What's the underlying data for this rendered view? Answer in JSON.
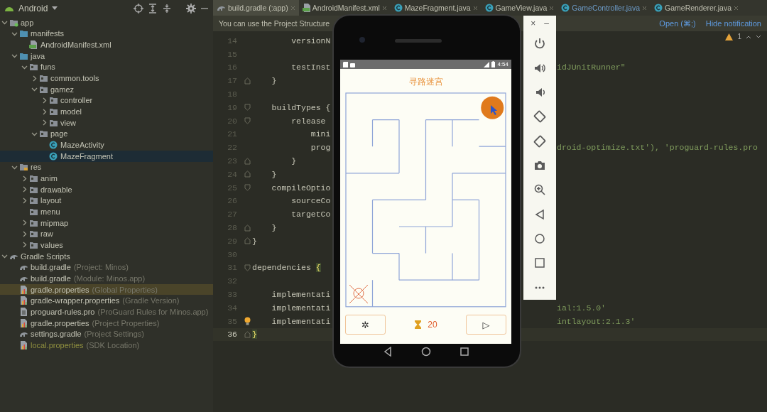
{
  "project_panel": {
    "view": "Android",
    "tree": [
      {
        "label": "app",
        "kind": "module",
        "expanded": true,
        "selected": false,
        "hovered": false,
        "children": [
          {
            "label": "manifests",
            "kind": "source-folder",
            "expanded": true,
            "selected": false,
            "hovered": false,
            "children": [
              {
                "label": "AndroidManifest.xml",
                "kind": "manifest",
                "selected": false,
                "hovered": false
              }
            ]
          },
          {
            "label": "java",
            "kind": "source-folder",
            "expanded": true,
            "selected": false,
            "hovered": false,
            "children": [
              {
                "label": "funs",
                "kind": "package",
                "expanded": true,
                "selected": false,
                "hovered": false,
                "children": [
                  {
                    "label": "common.tools",
                    "kind": "package",
                    "expanded": false,
                    "selected": false,
                    "hovered": false
                  },
                  {
                    "label": "gamez",
                    "kind": "package",
                    "expanded": true,
                    "selected": false,
                    "hovered": false,
                    "children": [
                      {
                        "label": "controller",
                        "kind": "package",
                        "expanded": false,
                        "selected": false,
                        "hovered": false
                      },
                      {
                        "label": "model",
                        "kind": "package",
                        "expanded": false,
                        "selected": false,
                        "hovered": false
                      },
                      {
                        "label": "view",
                        "kind": "package",
                        "expanded": false,
                        "selected": false,
                        "hovered": false
                      }
                    ]
                  },
                  {
                    "label": "page",
                    "kind": "package",
                    "expanded": true,
                    "selected": false,
                    "hovered": false,
                    "children": [
                      {
                        "label": "MazeActivity",
                        "kind": "class",
                        "selected": false,
                        "hovered": false
                      },
                      {
                        "label": "MazeFragment",
                        "kind": "class",
                        "selected": true,
                        "hovered": false
                      }
                    ]
                  }
                ]
              }
            ]
          },
          {
            "label": "res",
            "kind": "res-folder",
            "expanded": true,
            "selected": false,
            "hovered": false,
            "children": [
              {
                "label": "anim",
                "kind": "package",
                "expanded": false,
                "selected": false,
                "hovered": false
              },
              {
                "label": "drawable",
                "kind": "package",
                "expanded": false,
                "selected": false,
                "hovered": false
              },
              {
                "label": "layout",
                "kind": "package",
                "expanded": false,
                "selected": false,
                "hovered": false
              },
              {
                "label": "menu",
                "kind": "package",
                "selected": false,
                "hovered": false
              },
              {
                "label": "mipmap",
                "kind": "package",
                "expanded": false,
                "selected": false,
                "hovered": false
              },
              {
                "label": "raw",
                "kind": "package",
                "expanded": false,
                "selected": false,
                "hovered": false
              },
              {
                "label": "values",
                "kind": "package",
                "expanded": false,
                "selected": false,
                "hovered": false
              }
            ]
          }
        ]
      },
      {
        "label": "Gradle Scripts",
        "kind": "gradle",
        "expanded": true,
        "selected": false,
        "hovered": false,
        "children": [
          {
            "label": "build.gradle",
            "note": "(Project: Minos)",
            "kind": "gradle",
            "selected": false,
            "hovered": false
          },
          {
            "label": "build.gradle",
            "note": "(Module: Minos.app)",
            "kind": "gradle",
            "selected": false,
            "hovered": false
          },
          {
            "label": "gradle.properties",
            "note": "(Global Properties)",
            "kind": "properties",
            "selected": false,
            "hovered": true
          },
          {
            "label": "gradle-wrapper.properties",
            "note": "(Gradle Version)",
            "kind": "properties",
            "selected": false,
            "hovered": false
          },
          {
            "label": "proguard-rules.pro",
            "note": "(ProGuard Rules for Minos.app)",
            "kind": "file",
            "selected": false,
            "hovered": false
          },
          {
            "label": "gradle.properties",
            "note": "(Project Properties)",
            "kind": "properties",
            "selected": false,
            "hovered": false
          },
          {
            "label": "settings.gradle",
            "note": "(Project Settings)",
            "kind": "gradle",
            "selected": false,
            "hovered": false
          },
          {
            "label": "local.properties",
            "note": "(SDK Location)",
            "kind": "ignored-properties",
            "selected": false,
            "hovered": false
          }
        ]
      }
    ]
  },
  "editor": {
    "tabs": [
      {
        "label": "build.gradle (:app)",
        "kind": "gradle",
        "selected": true,
        "modified": false
      },
      {
        "label": "AndroidManifest.xml",
        "kind": "manifest",
        "selected": false,
        "modified": false
      },
      {
        "label": "MazeFragment.java",
        "kind": "class",
        "selected": false,
        "modified": false
      },
      {
        "label": "GameView.java",
        "kind": "class",
        "selected": false,
        "modified": false
      },
      {
        "label": "GameController.java",
        "kind": "class",
        "selected": false,
        "modified": true
      },
      {
        "label": "GameRenderer.java",
        "kind": "class",
        "selected": false,
        "modified": false
      }
    ],
    "notification": {
      "text": "You can use the Project Structure",
      "actions": [
        "Open (⌘;)",
        "Hide notification"
      ]
    },
    "warnings": "1",
    "lines": [
      {
        "number": "14",
        "kind": "plain",
        "code": "        versionN",
        "current": false
      },
      {
        "number": "15",
        "kind": "plain",
        "current": false
      },
      {
        "number": "16",
        "kind": "plain",
        "code": "        testInst",
        "tail": "idJUnitRunner\"",
        "current": false
      },
      {
        "number": "17",
        "kind": "fold-end",
        "code": "    }",
        "current": false
      },
      {
        "number": "18",
        "kind": "plain",
        "current": false
      },
      {
        "number": "19",
        "kind": "fold-start",
        "code": "    buildTypes {",
        "current": false
      },
      {
        "number": "20",
        "kind": "fold-start",
        "code": "        release",
        "current": false
      },
      {
        "number": "21",
        "kind": "plain",
        "code": "            mini",
        "current": false
      },
      {
        "number": "22",
        "kind": "plain",
        "code": "            prog",
        "tail": "droid-optimize.txt'), 'proguard-rules.pro",
        "current": false
      },
      {
        "number": "23",
        "kind": "fold-end",
        "code": "        }",
        "current": false
      },
      {
        "number": "24",
        "kind": "fold-end",
        "code": "    }",
        "current": false
      },
      {
        "number": "25",
        "kind": "fold-start",
        "code": "    compileOptio",
        "current": false
      },
      {
        "number": "26",
        "kind": "plain",
        "code": "        sourceCo",
        "current": false
      },
      {
        "number": "27",
        "kind": "plain",
        "code": "        targetCo",
        "current": false
      },
      {
        "number": "28",
        "kind": "fold-end",
        "code": "    }",
        "current": false
      },
      {
        "number": "29",
        "kind": "fold-end",
        "code": "}",
        "current": false
      },
      {
        "number": "30",
        "kind": "plain",
        "current": false
      },
      {
        "number": "31",
        "kind": "fold-start",
        "code": "dependencies {",
        "brace_match": true,
        "current": false
      },
      {
        "number": "32",
        "kind": "plain",
        "current": false
      },
      {
        "number": "33",
        "kind": "plain",
        "code": "    implementati",
        "current": false
      },
      {
        "number": "34",
        "kind": "plain",
        "code": "    implementati",
        "tail": "ial:1.5.0'",
        "current": false
      },
      {
        "number": "35",
        "kind": "plain",
        "code": "    implementati",
        "tail": "intlayout:2.1.3'",
        "bulb": true,
        "current": false
      },
      {
        "number": "36",
        "kind": "fold-end",
        "code": "}",
        "brace_match": true,
        "current": true
      }
    ]
  },
  "emulator": {
    "status_bar": {
      "time": "4:54"
    },
    "app": {
      "title": "寻路迷宫",
      "left_button": "✲",
      "score": "20",
      "right_button": "▷"
    }
  },
  "emulator_toolbar": {
    "close": "×",
    "minimize": "–"
  }
}
